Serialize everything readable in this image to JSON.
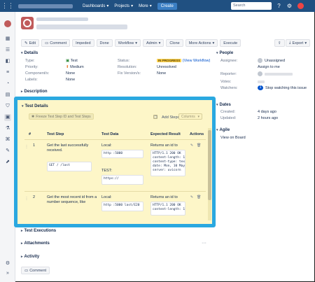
{
  "nav": {
    "dashboards": "Dashboards",
    "projects": "Projects",
    "more": "More",
    "create": "Create",
    "search_placeholder": "Search"
  },
  "toolbar": {
    "edit": "Edit",
    "comment": "Comment",
    "impeded": "Impeded",
    "done": "Done",
    "workflow": "Workflow",
    "admin": "Admin",
    "clone": "Clone",
    "more_actions": "More Actions",
    "execute": "Execute",
    "export": "Export"
  },
  "details": {
    "heading": "Details",
    "type_k": "Type:",
    "type_v": "Test",
    "priority_k": "Priority:",
    "priority_v": "Medium",
    "components_k": "Component/s:",
    "components_v": "None",
    "labels_k": "Labels:",
    "labels_v": "None",
    "status_k": "Status:",
    "status_v": "IN PROGRESS",
    "status_link": "(View Workflow)",
    "resolution_k": "Resolution:",
    "resolution_v": "Unresolved",
    "fixversions_k": "Fix Version/s:",
    "fixversions_v": "None"
  },
  "description": {
    "heading": "Description"
  },
  "test_details": {
    "heading": "Test Details",
    "freeze_button": "Freeze Test Step ID and Test Steps",
    "add_steps": "Add Steps",
    "columns": "Columns",
    "headers": {
      "num": "#",
      "step": "Test Step",
      "data": "Test Data",
      "expected": "Expected Result",
      "actions": "Actions"
    },
    "rows": [
      {
        "num": "1",
        "step": "Get the last          successfully received.",
        "step_code": "GET /           /last",
        "data_label1": "Local:",
        "data_code1": "http :5000",
        "data_label2": "TEST:",
        "data_code2": "https://",
        "expected": "Returns an           id to",
        "expected_code": "HTTP/1.1 200 OK\ncontent-length: 1\ncontent-type: tex\ndate: Mon, 10 May\nserver: uvicorn"
      },
      {
        "num": "2",
        "step": "Get the most recent        id from a number sequence, like",
        "data_label1": "Local:",
        "data_code1": "http :5000          last/E20",
        "expected": "Returns an           id to",
        "expected_code": "HTTP/1.1 200 OK\ncontent-length: 1"
      }
    ]
  },
  "sections": {
    "test_executions": "Test Executions",
    "attachments": "Attachments",
    "activity": "Activity"
  },
  "comment_button": "Comment",
  "people": {
    "heading": "People",
    "assignee_k": "Assignee:",
    "assignee_v": "Unassigned",
    "assign_to_me": "Assign to me",
    "reporter_k": "Reporter:",
    "votes_k": "Votes:",
    "watchers_k": "Watchers:",
    "watchers_count": "1",
    "stop_watching": "Stop watching this issue"
  },
  "dates": {
    "heading": "Dates",
    "created_k": "Created:",
    "created_v": "4 days ago",
    "updated_k": "Updated:",
    "updated_v": "2 hours ago"
  },
  "agile": {
    "heading": "Agile",
    "view_on_board": "View on Board"
  },
  "colors": {
    "nav_bg": "#205081",
    "highlight_border": "#2aa8e0",
    "panel_bg": "#fdf6c8",
    "status_badge": "#ffd351"
  }
}
